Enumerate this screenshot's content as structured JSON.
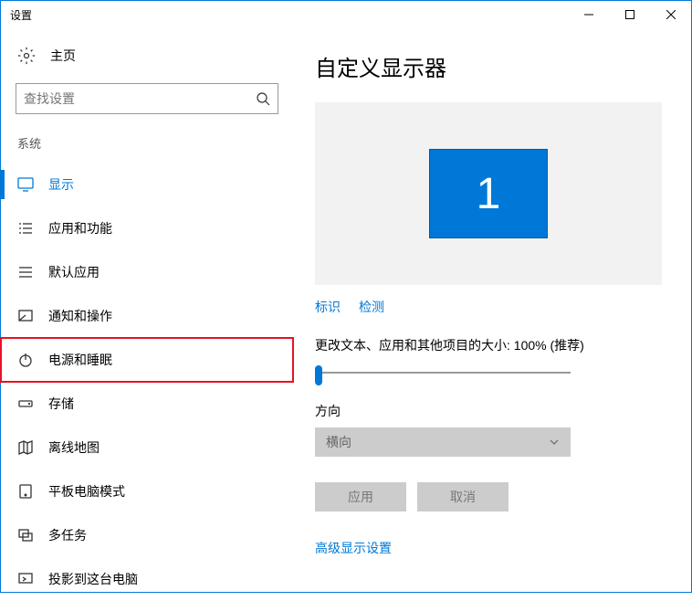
{
  "window": {
    "title": "设置"
  },
  "sidebar": {
    "home": "主页",
    "search_placeholder": "查找设置",
    "section": "系统",
    "items": [
      {
        "label": "显示"
      },
      {
        "label": "应用和功能"
      },
      {
        "label": "默认应用"
      },
      {
        "label": "通知和操作"
      },
      {
        "label": "电源和睡眠"
      },
      {
        "label": "存储"
      },
      {
        "label": "离线地图"
      },
      {
        "label": "平板电脑模式"
      },
      {
        "label": "多任务"
      },
      {
        "label": "投影到这台电脑"
      }
    ]
  },
  "main": {
    "heading": "自定义显示器",
    "monitor_number": "1",
    "identify": "标识",
    "detect": "检测",
    "scale_label": "更改文本、应用和其他项目的大小: 100% (推荐)",
    "orientation_label": "方向",
    "orientation_value": "横向",
    "apply": "应用",
    "cancel": "取消",
    "advanced": "高级显示设置"
  }
}
